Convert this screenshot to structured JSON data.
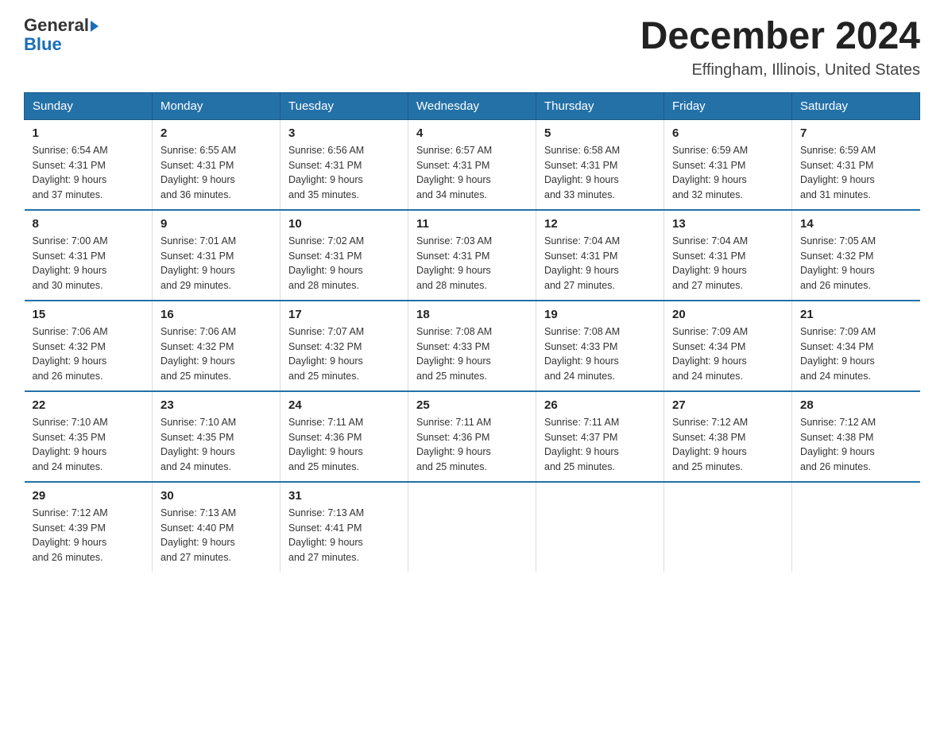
{
  "header": {
    "logo": {
      "general": "General",
      "blue": "Blue"
    },
    "title": "December 2024",
    "subtitle": "Effingham, Illinois, United States"
  },
  "days_of_week": [
    "Sunday",
    "Monday",
    "Tuesday",
    "Wednesday",
    "Thursday",
    "Friday",
    "Saturday"
  ],
  "weeks": [
    [
      {
        "day": "1",
        "sunrise": "6:54 AM",
        "sunset": "4:31 PM",
        "daylight": "9 hours and 37 minutes."
      },
      {
        "day": "2",
        "sunrise": "6:55 AM",
        "sunset": "4:31 PM",
        "daylight": "9 hours and 36 minutes."
      },
      {
        "day": "3",
        "sunrise": "6:56 AM",
        "sunset": "4:31 PM",
        "daylight": "9 hours and 35 minutes."
      },
      {
        "day": "4",
        "sunrise": "6:57 AM",
        "sunset": "4:31 PM",
        "daylight": "9 hours and 34 minutes."
      },
      {
        "day": "5",
        "sunrise": "6:58 AM",
        "sunset": "4:31 PM",
        "daylight": "9 hours and 33 minutes."
      },
      {
        "day": "6",
        "sunrise": "6:59 AM",
        "sunset": "4:31 PM",
        "daylight": "9 hours and 32 minutes."
      },
      {
        "day": "7",
        "sunrise": "6:59 AM",
        "sunset": "4:31 PM",
        "daylight": "9 hours and 31 minutes."
      }
    ],
    [
      {
        "day": "8",
        "sunrise": "7:00 AM",
        "sunset": "4:31 PM",
        "daylight": "9 hours and 30 minutes."
      },
      {
        "day": "9",
        "sunrise": "7:01 AM",
        "sunset": "4:31 PM",
        "daylight": "9 hours and 29 minutes."
      },
      {
        "day": "10",
        "sunrise": "7:02 AM",
        "sunset": "4:31 PM",
        "daylight": "9 hours and 28 minutes."
      },
      {
        "day": "11",
        "sunrise": "7:03 AM",
        "sunset": "4:31 PM",
        "daylight": "9 hours and 28 minutes."
      },
      {
        "day": "12",
        "sunrise": "7:04 AM",
        "sunset": "4:31 PM",
        "daylight": "9 hours and 27 minutes."
      },
      {
        "day": "13",
        "sunrise": "7:04 AM",
        "sunset": "4:31 PM",
        "daylight": "9 hours and 27 minutes."
      },
      {
        "day": "14",
        "sunrise": "7:05 AM",
        "sunset": "4:32 PM",
        "daylight": "9 hours and 26 minutes."
      }
    ],
    [
      {
        "day": "15",
        "sunrise": "7:06 AM",
        "sunset": "4:32 PM",
        "daylight": "9 hours and 26 minutes."
      },
      {
        "day": "16",
        "sunrise": "7:06 AM",
        "sunset": "4:32 PM",
        "daylight": "9 hours and 25 minutes."
      },
      {
        "day": "17",
        "sunrise": "7:07 AM",
        "sunset": "4:32 PM",
        "daylight": "9 hours and 25 minutes."
      },
      {
        "day": "18",
        "sunrise": "7:08 AM",
        "sunset": "4:33 PM",
        "daylight": "9 hours and 25 minutes."
      },
      {
        "day": "19",
        "sunrise": "7:08 AM",
        "sunset": "4:33 PM",
        "daylight": "9 hours and 24 minutes."
      },
      {
        "day": "20",
        "sunrise": "7:09 AM",
        "sunset": "4:34 PM",
        "daylight": "9 hours and 24 minutes."
      },
      {
        "day": "21",
        "sunrise": "7:09 AM",
        "sunset": "4:34 PM",
        "daylight": "9 hours and 24 minutes."
      }
    ],
    [
      {
        "day": "22",
        "sunrise": "7:10 AM",
        "sunset": "4:35 PM",
        "daylight": "9 hours and 24 minutes."
      },
      {
        "day": "23",
        "sunrise": "7:10 AM",
        "sunset": "4:35 PM",
        "daylight": "9 hours and 24 minutes."
      },
      {
        "day": "24",
        "sunrise": "7:11 AM",
        "sunset": "4:36 PM",
        "daylight": "9 hours and 25 minutes."
      },
      {
        "day": "25",
        "sunrise": "7:11 AM",
        "sunset": "4:36 PM",
        "daylight": "9 hours and 25 minutes."
      },
      {
        "day": "26",
        "sunrise": "7:11 AM",
        "sunset": "4:37 PM",
        "daylight": "9 hours and 25 minutes."
      },
      {
        "day": "27",
        "sunrise": "7:12 AM",
        "sunset": "4:38 PM",
        "daylight": "9 hours and 25 minutes."
      },
      {
        "day": "28",
        "sunrise": "7:12 AM",
        "sunset": "4:38 PM",
        "daylight": "9 hours and 26 minutes."
      }
    ],
    [
      {
        "day": "29",
        "sunrise": "7:12 AM",
        "sunset": "4:39 PM",
        "daylight": "9 hours and 26 minutes."
      },
      {
        "day": "30",
        "sunrise": "7:13 AM",
        "sunset": "4:40 PM",
        "daylight": "9 hours and 27 minutes."
      },
      {
        "day": "31",
        "sunrise": "7:13 AM",
        "sunset": "4:41 PM",
        "daylight": "9 hours and 27 minutes."
      },
      null,
      null,
      null,
      null
    ]
  ],
  "labels": {
    "sunrise": "Sunrise:",
    "sunset": "Sunset:",
    "daylight": "Daylight:"
  }
}
